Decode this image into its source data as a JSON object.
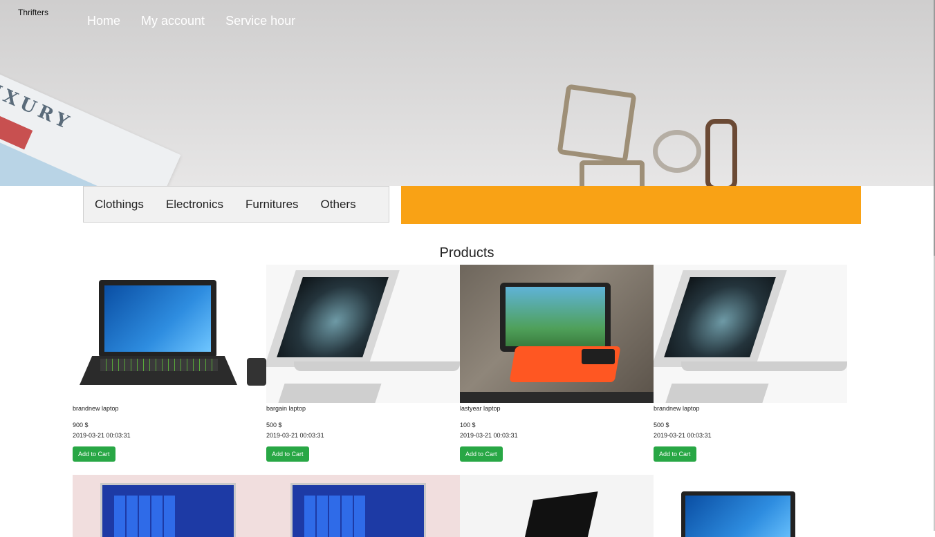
{
  "header": {
    "brand": "Thrifters",
    "nav": [
      "Home",
      "My account",
      "Service hour"
    ]
  },
  "hero": {
    "magazine_text": "LUXURY"
  },
  "categories": [
    "Clothings",
    "Electronics",
    "Furnitures",
    "Others"
  ],
  "products_title": "Products",
  "products": [
    {
      "name": "brandnew laptop",
      "price": "900 $",
      "date": "2019-03-21 00:03:31",
      "button": "Add to Cart"
    },
    {
      "name": "bargain laptop",
      "price": "500 $",
      "date": "2019-03-21 00:03:31",
      "button": "Add to Cart"
    },
    {
      "name": "lastyear laptop",
      "price": "100 $",
      "date": "2019-03-21 00:03:31",
      "button": "Add to Cart"
    },
    {
      "name": "brandnew laptop",
      "price": "500 $",
      "date": "2019-03-21 00:03:31",
      "button": "Add to Cart"
    }
  ],
  "colors": {
    "accent_orange": "#f9a215",
    "button_green": "#28a745"
  }
}
